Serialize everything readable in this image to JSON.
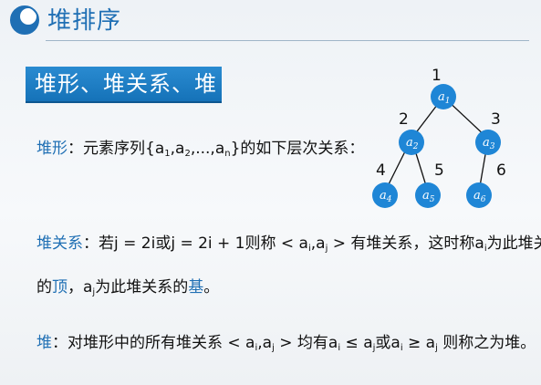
{
  "header": {
    "title": "堆排序"
  },
  "section": {
    "label": "堆形、堆关系、堆"
  },
  "def_shape": {
    "term": "堆形",
    "colon": "：",
    "text1": "元素序列{a",
    "sub1": "1",
    "text2": ",a",
    "sub2": "2",
    "text3": ",...,a",
    "subn": "n",
    "text4": "}的如下层次关系："
  },
  "def_relation": {
    "term": "堆关系",
    "colon": "：",
    "text1": "若j = 2i或j = 2i + 1则称 < a",
    "sub_i": "i",
    "text2": ",a",
    "sub_j": "j",
    "text3": " > 有堆关系，这时称a",
    "sub_i2": "i",
    "text4": "为此堆关系",
    "line2_prefix": "的",
    "top_word": "顶",
    "line2_mid": "，a",
    "sub_j2": "j",
    "line2_text": "为此堆关系的",
    "base_word": "基",
    "line2_end": "。"
  },
  "def_heap": {
    "term": "堆",
    "colon": "：",
    "text1": "对堆形中的所有堆关系 < a",
    "sub_i": "i",
    "text2": ",a",
    "sub_j": "j",
    "text3": " > 均有a",
    "sub_i2": "i",
    "text4": " ≤ a",
    "sub_j2": "j",
    "text5": "或a",
    "sub_i3": "i",
    "text6": " ≥ a",
    "sub_j3": "j",
    "text7": " 则称之为堆。"
  },
  "tree": {
    "nodes": [
      {
        "number": "1",
        "var": "a",
        "sub": "1"
      },
      {
        "number": "2",
        "var": "a",
        "sub": "2"
      },
      {
        "number": "3",
        "var": "a",
        "sub": "3"
      },
      {
        "number": "4",
        "var": "a",
        "sub": "4"
      },
      {
        "number": "5",
        "var": "a",
        "sub": "5"
      },
      {
        "number": "6",
        "var": "a",
        "sub": "6"
      }
    ],
    "node_color": "#1f86d6"
  },
  "colors": {
    "accent": "#1f6fb4",
    "bar": "#1572b8"
  }
}
